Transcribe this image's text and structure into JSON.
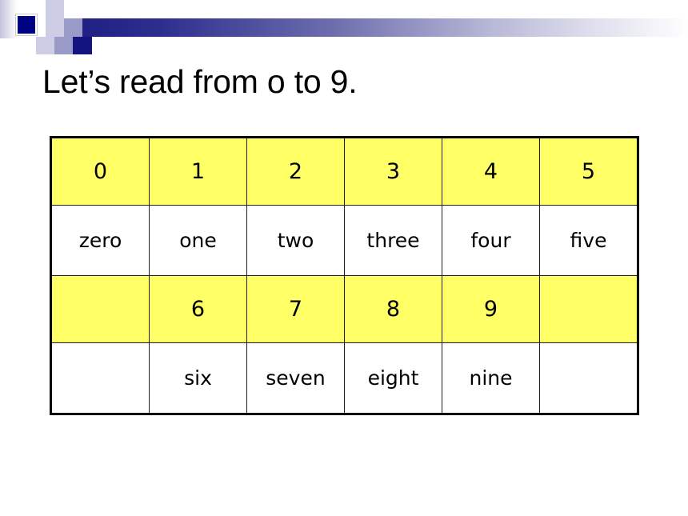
{
  "slide": {
    "title": "Let’s read from o to 9.",
    "background_color": "#ffffff"
  },
  "decor": {
    "band_gradient_from": "#191980",
    "band_gradient_to": "#ffffff",
    "accent_navy": "#000082",
    "accent_mid": "#9a9ac8",
    "accent_pale": "#ccccE4",
    "accent_deep": "#141480"
  },
  "table": {
    "border_color": "#231f20",
    "digit_row_bg": "#ffff66",
    "word_row_bg": "#ffffff",
    "columns": 6,
    "rows": [
      {
        "kind": "digits",
        "cells": [
          "0",
          "1",
          "2",
          "3",
          "4",
          "5"
        ]
      },
      {
        "kind": "words",
        "cells": [
          "zero",
          "one",
          "two",
          "three",
          "four",
          "five"
        ]
      },
      {
        "kind": "digits",
        "cells": [
          "",
          "6",
          "7",
          "8",
          "9",
          ""
        ]
      },
      {
        "kind": "words",
        "cells": [
          "",
          "six",
          "seven",
          "eight",
          "nine",
          ""
        ]
      }
    ]
  }
}
